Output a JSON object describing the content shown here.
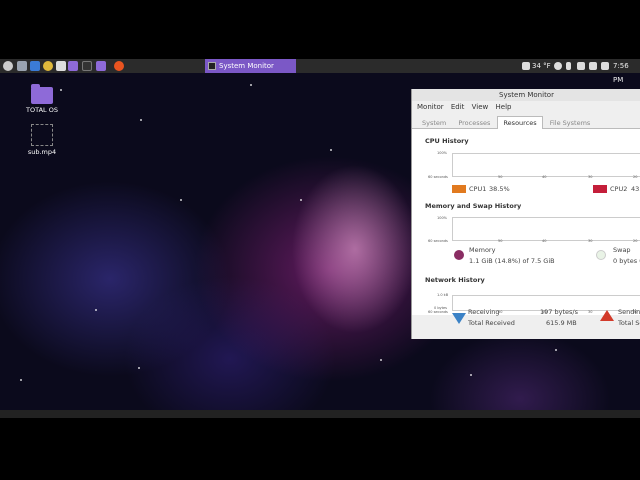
{
  "desktop": {
    "icons": [
      {
        "label": "TOTAL OS"
      },
      {
        "label": "sub.mp4"
      }
    ]
  },
  "panel": {
    "taskbar_item": "System Monitor",
    "weather": "34 °F",
    "clock": "7:56 PM",
    "launcher_icons": [
      "menu-icon",
      "files-icon",
      "document-icon",
      "chrome-icon",
      "terminal-icon",
      "folder-icon",
      "terminal2-icon",
      "folder2-icon",
      "ubuntu-icon"
    ]
  },
  "window": {
    "title": "System Monitor",
    "menu": [
      "Monitor",
      "Edit",
      "View",
      "Help"
    ],
    "tabs": [
      "System",
      "Processes",
      "Resources",
      "File Systems"
    ],
    "active_tab": "Resources",
    "cpu": {
      "title": "CPU History",
      "ymax": "100%",
      "ymin": "0%",
      "x_ticks": [
        "60 seconds",
        "50",
        "40",
        "30",
        "20"
      ],
      "cpu1_label": "CPU1",
      "cpu1_value": "38.5%",
      "cpu2_label": "CPU2",
      "cpu2_value": "43.",
      "cpu1_color": "#e17a1f",
      "cpu2_color": "#c41e3a"
    },
    "memory": {
      "title": "Memory and Swap History",
      "ymax": "100%",
      "ymin": "0%",
      "x_ticks": [
        "60 seconds",
        "50",
        "40",
        "30",
        "20"
      ],
      "memory_label": "Memory",
      "memory_value": "1.1 GiB (14.8%) of 7.5 GiB",
      "swap_label": "Swap",
      "swap_value": "0 bytes (0"
    },
    "network": {
      "title": "Network History",
      "ymax": "1.0 kB",
      "ymin": "0 bytes",
      "x_ticks": [
        "60 seconds",
        "50",
        "40",
        "30",
        "20"
      ],
      "receiving_label": "Receiving",
      "receiving_value": "197 bytes/s",
      "total_received_label": "Total Received",
      "total_received_value": "615.9 MB",
      "sending_label": "Sendin",
      "total_sent_label": "Total Se"
    }
  }
}
